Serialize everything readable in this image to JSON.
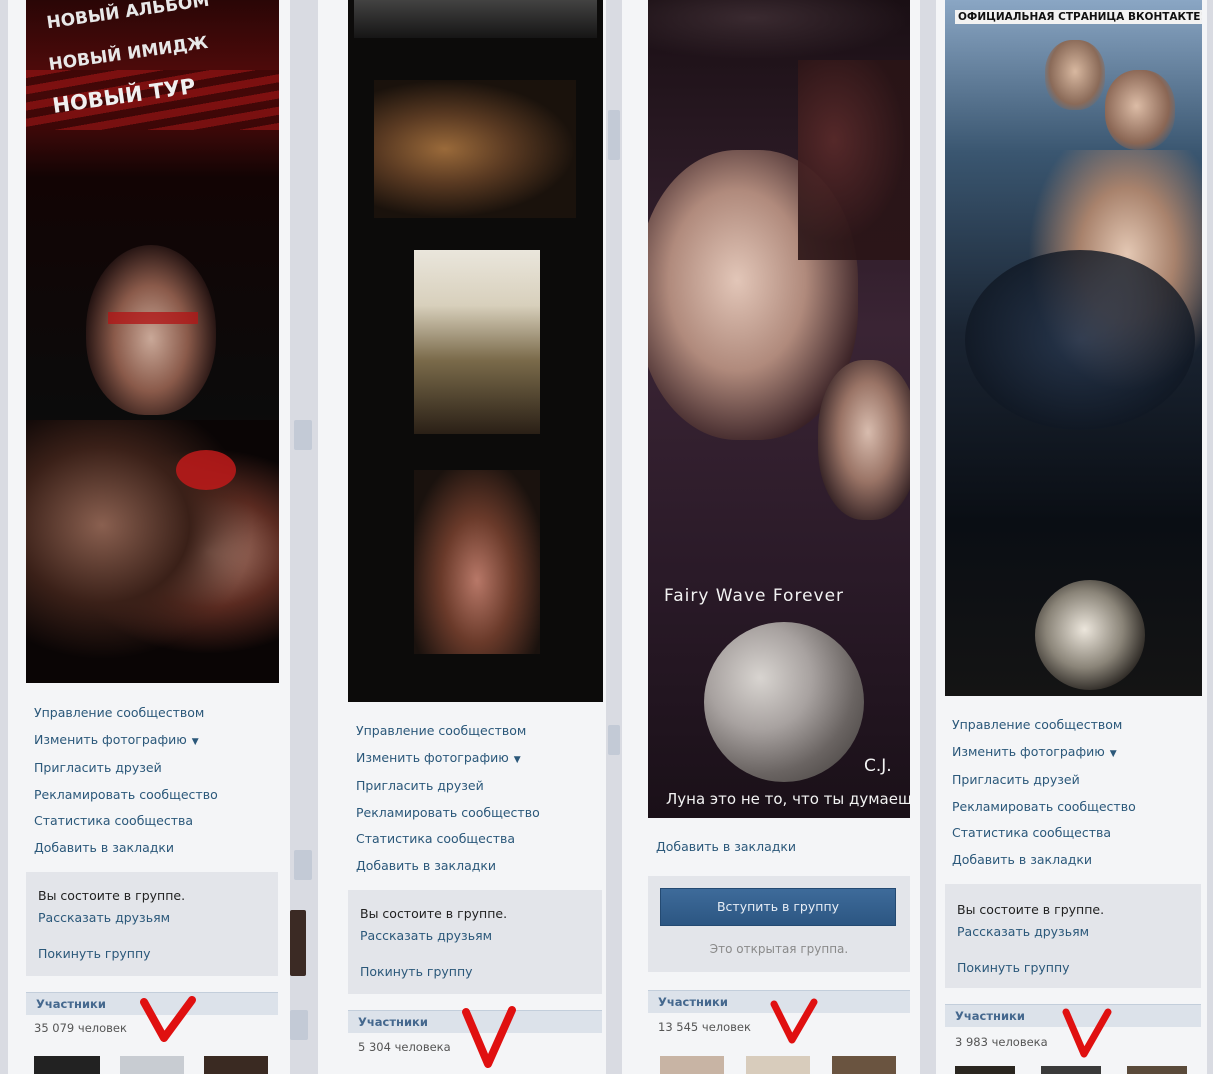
{
  "panel1": {
    "poster_lines": [
      "НОВЫЙ АЛЬБОМ",
      "НОВЫЙ ИМИДЖ",
      "НОВЫЙ ТУР"
    ],
    "menu": [
      {
        "label": "Управление сообществом"
      },
      {
        "label": "Изменить фотографию",
        "caret": "▼"
      },
      {
        "label": "Пригласить друзей"
      },
      {
        "label": "Рекламировать сообщество"
      },
      {
        "label": "Статистика сообщества"
      },
      {
        "label": "Добавить в закладки"
      }
    ],
    "status": {
      "title": "Вы состоите в группе.",
      "tell": "Рассказать друзьям",
      "leave": "Покинуть группу"
    },
    "members": {
      "title": "Участники",
      "count": "35 079 человек"
    }
  },
  "panel2": {
    "menu": [
      {
        "label": "Управление сообществом"
      },
      {
        "label": "Изменить фотографию",
        "caret": "▼"
      },
      {
        "label": "Пригласить друзей"
      },
      {
        "label": "Рекламировать сообщество"
      },
      {
        "label": "Статистика сообщества"
      },
      {
        "label": "Добавить в закладки"
      }
    ],
    "status": {
      "title": "Вы состоите в группе.",
      "tell": "Рассказать друзьям",
      "leave": "Покинуть группу"
    },
    "members": {
      "title": "Участники",
      "count": "5 304 человека"
    }
  },
  "panel3": {
    "poster_title": "Fairy Wave Forever",
    "poster_signature": "C.J.",
    "poster_caption": "Луна это не то, что ты думаешь",
    "menu": [
      {
        "label": "Добавить в закладки"
      }
    ],
    "join_button": "Вступить в группу",
    "open_note": "Это открытая группа.",
    "members": {
      "title": "Участники",
      "count": "13 545 человек"
    }
  },
  "panel4": {
    "poster_header": "ОФИЦИАЛЬНАЯ СТРАНИЦА ВКОНТАКТЕ!",
    "menu": [
      {
        "label": "Управление сообществом"
      },
      {
        "label": "Изменить фотографию",
        "caret": "▼"
      },
      {
        "label": "Пригласить друзей"
      },
      {
        "label": "Рекламировать сообщество"
      },
      {
        "label": "Статистика сообщества"
      },
      {
        "label": "Добавить в закладки"
      }
    ],
    "status": {
      "title": "Вы состоите в группе.",
      "tell": "Рассказать друзьям",
      "leave": "Покинуть группу"
    },
    "members": {
      "title": "Участники",
      "count": "3 983 человека"
    }
  },
  "colors": {
    "link": "#2b587a",
    "accent_mark": "#e01010",
    "header_bg": "#dce2ea"
  },
  "icons": [
    "red-checkmark-icon",
    "caret-down-icon"
  ]
}
